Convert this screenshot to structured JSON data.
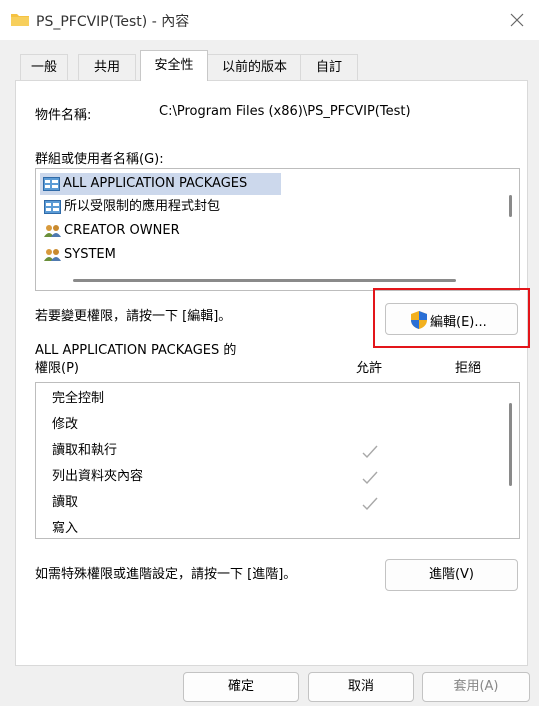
{
  "window": {
    "title": "PS_PFCVIP(Test) - 內容"
  },
  "tabs": [
    {
      "label": "一般"
    },
    {
      "label": "共用"
    },
    {
      "label": "安全性"
    },
    {
      "label": "以前的版本"
    },
    {
      "label": "自訂"
    }
  ],
  "object": {
    "label": "物件名稱:",
    "value": "C:\\Program Files (x86)\\PS_PFCVIP(Test)"
  },
  "groups": {
    "label": "群組或使用者名稱(G):",
    "items": [
      {
        "label": "ALL APPLICATION PACKAGES",
        "icon": "app-packages-icon",
        "selected": true
      },
      {
        "label": "所以受限制的應用程式封包",
        "icon": "app-packages-icon"
      },
      {
        "label": "CREATOR OWNER",
        "icon": "users-icon"
      },
      {
        "label": "SYSTEM",
        "icon": "users-icon"
      }
    ]
  },
  "change_hint": "若要變更權限，請按一下 [編輯]。",
  "edit_button": {
    "label": "編輯(E)...",
    "icon": "uac-shield-icon"
  },
  "permissions": {
    "header_line1": "ALL APPLICATION PACKAGES 的",
    "header_line2": "權限(P)",
    "allow_label": "允許",
    "deny_label": "拒絕",
    "rows": [
      {
        "name": "完全控制",
        "allow": false,
        "deny": false
      },
      {
        "name": "修改",
        "allow": false,
        "deny": false
      },
      {
        "name": "讀取和執行",
        "allow": true,
        "deny": false
      },
      {
        "name": "列出資料夾內容",
        "allow": true,
        "deny": false
      },
      {
        "name": "讀取",
        "allow": true,
        "deny": false
      },
      {
        "name": "寫入",
        "allow": false,
        "deny": false
      }
    ]
  },
  "advanced_hint": "如需特殊權限或進階設定，請按一下 [進階]。",
  "advanced_button": {
    "label": "進階(V)"
  },
  "footer": {
    "ok_label": "確定",
    "cancel_label": "取消",
    "apply_label": "套用(A)"
  },
  "colors": {
    "highlight": "#e3151a",
    "selection": "#ccd8ec",
    "folder": "#f5c242"
  }
}
